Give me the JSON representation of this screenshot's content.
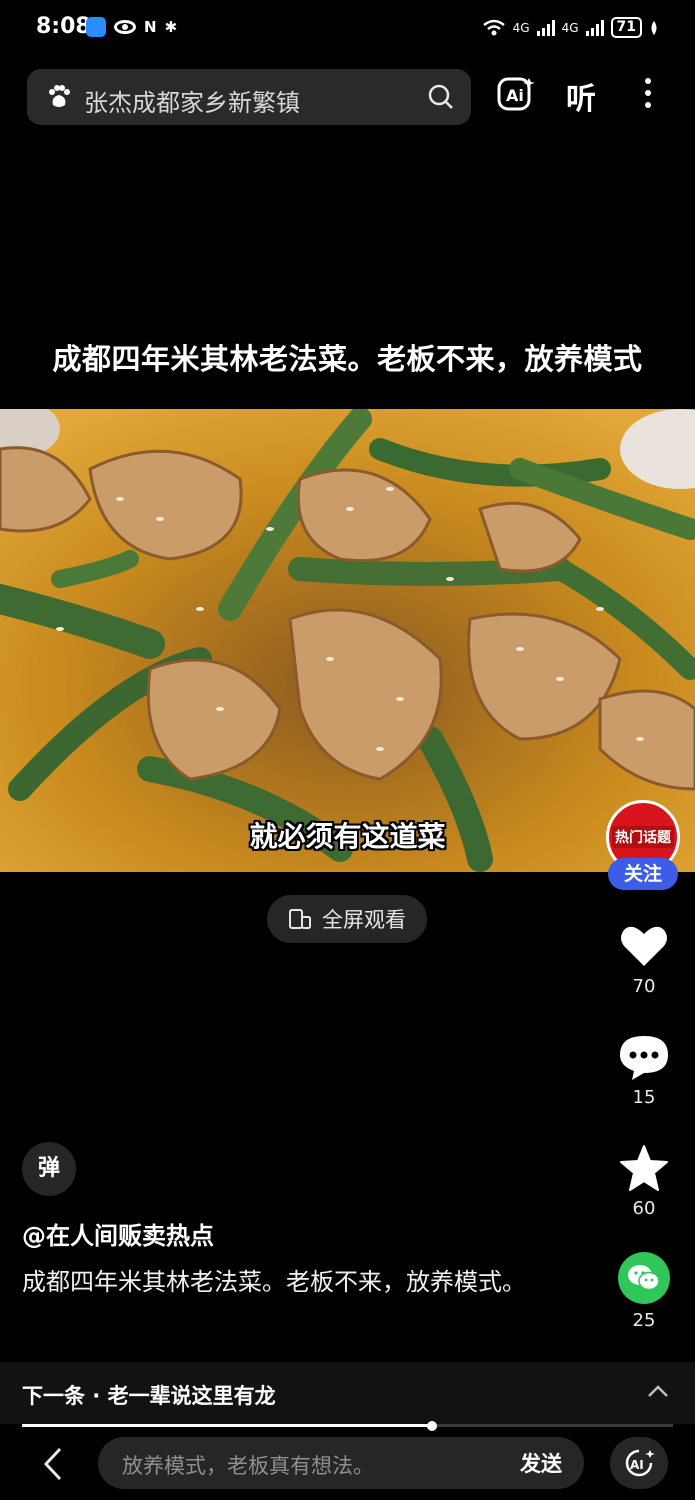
{
  "status_bar": {
    "time": "8:08",
    "nfc_glyph": "N",
    "bluetooth_glyph": "✱",
    "network_1": "4G",
    "network_2": "4G",
    "battery": "71"
  },
  "search": {
    "query": "张杰成都家乡新繁镇",
    "icon": "search-icon"
  },
  "header": {
    "listen_label": "听"
  },
  "video": {
    "title": "成都四年米其林老法菜。老板不来，放养模式",
    "subtitle": "就必须有这道菜",
    "progress_fraction": 0.63
  },
  "fullscreen": {
    "label": "全屏观看"
  },
  "creator": {
    "badge_text": "热门话题",
    "follow_label": "关注"
  },
  "actions": {
    "likes": "70",
    "comments": "15",
    "favorites": "60",
    "shares": "25"
  },
  "danmu_label": "弹",
  "post": {
    "author": "@在人间贩卖热点",
    "caption": "成都四年米其林老法菜。老板不来，放养模式。"
  },
  "next_up": {
    "text": "下一条 · 老一辈说这里有龙"
  },
  "comment_input": {
    "placeholder": "放养模式，老板真有想法。",
    "send_label": "发送"
  },
  "colors": {
    "follow": "#3d5ce8",
    "wechat": "#2fc65a",
    "badge": "#d8151c"
  }
}
